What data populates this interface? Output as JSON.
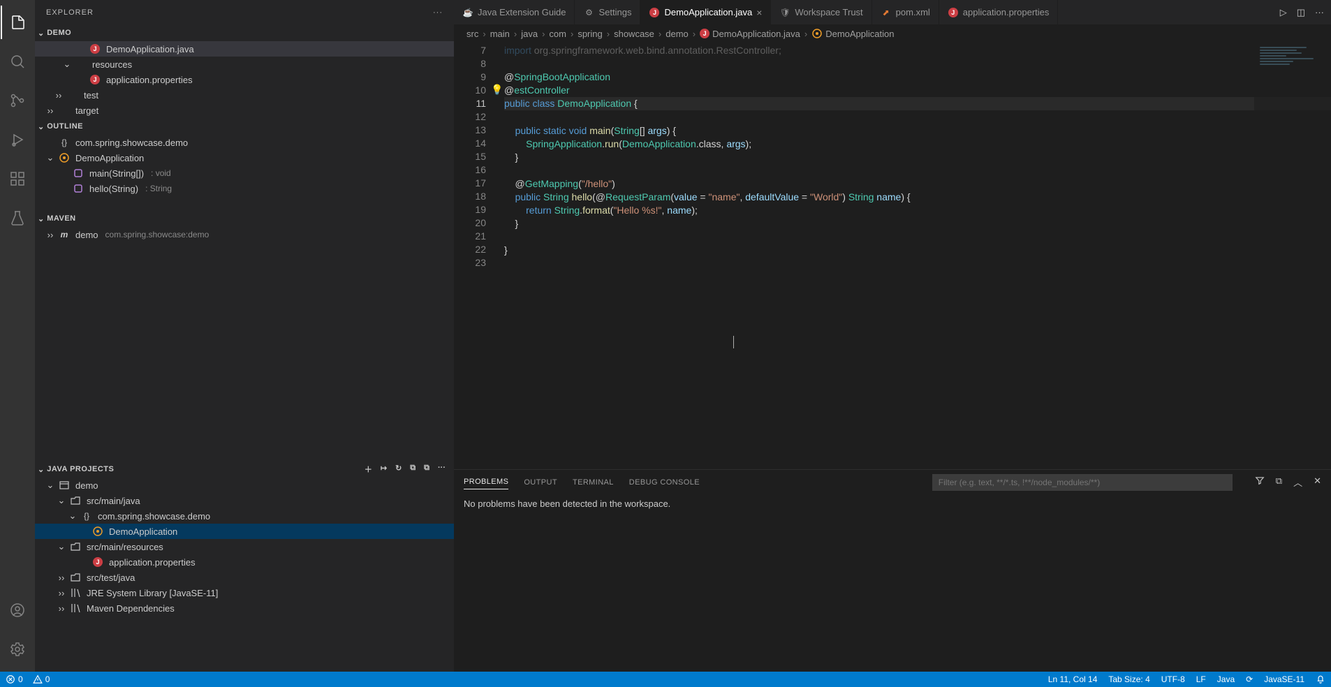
{
  "sidebar": {
    "title": "EXPLORER",
    "sections": {
      "demo": {
        "label": "DEMO",
        "items": [
          {
            "label": "DemoApplication.java",
            "kind": "java",
            "indent": 58,
            "active": true
          },
          {
            "label": "resources",
            "kind": "folder-open",
            "indent": 38
          },
          {
            "label": "application.properties",
            "kind": "prop",
            "indent": 58
          },
          {
            "label": "test",
            "kind": "folder",
            "indent": 26,
            "collapsed": true
          },
          {
            "label": "target",
            "kind": "folder",
            "indent": 14,
            "collapsed": true
          }
        ]
      },
      "outline": {
        "label": "OUTLINE",
        "items": [
          {
            "label": "com.spring.showcase.demo",
            "icon": "ns",
            "indent": 14
          },
          {
            "label": "DemoApplication",
            "icon": "class",
            "indent": 14,
            "expandable": true,
            "expanded": true
          },
          {
            "label": "main(String[])",
            "hint": ": void",
            "icon": "method",
            "indent": 34
          },
          {
            "label": "hello(String)",
            "hint": ": String",
            "icon": "method",
            "indent": 34
          }
        ]
      },
      "maven": {
        "label": "MAVEN",
        "items": [
          {
            "label": "demo",
            "hint": "com.spring.showcase:demo",
            "icon": "maven",
            "indent": 14,
            "collapsed": true
          }
        ]
      },
      "javaProjects": {
        "label": "JAVA PROJECTS",
        "items": [
          {
            "label": "demo",
            "icon": "proj",
            "indent": 14,
            "expandable": true,
            "expanded": true
          },
          {
            "label": "src/main/java",
            "icon": "pkg-root",
            "indent": 30,
            "expandable": true,
            "expanded": true
          },
          {
            "label": "com.spring.showcase.demo",
            "icon": "ns",
            "indent": 46,
            "expandable": true,
            "expanded": true
          },
          {
            "label": "DemoApplication",
            "icon": "class",
            "indent": 62,
            "selected": true
          },
          {
            "label": "src/main/resources",
            "icon": "pkg-root",
            "indent": 30,
            "expandable": true,
            "expanded": true
          },
          {
            "label": "application.properties",
            "icon": "prop",
            "indent": 62
          },
          {
            "label": "src/test/java",
            "icon": "pkg-root",
            "indent": 30,
            "collapsed": true
          },
          {
            "label": "JRE System Library [JavaSE-11]",
            "icon": "lib",
            "indent": 30,
            "collapsed": true
          },
          {
            "label": "Maven Dependencies",
            "icon": "lib",
            "indent": 30,
            "collapsed": true
          }
        ]
      }
    }
  },
  "tabs": [
    {
      "label": "Java Extension Guide",
      "icon": "coffee"
    },
    {
      "label": "Settings",
      "icon": "settings"
    },
    {
      "label": "DemoApplication.java",
      "icon": "java",
      "active": true,
      "close": true
    },
    {
      "label": "Workspace Trust",
      "icon": "shield"
    },
    {
      "label": "pom.xml",
      "icon": "xml"
    },
    {
      "label": "application.properties",
      "icon": "prop"
    }
  ],
  "breadcrumbs": [
    "src",
    "main",
    "java",
    "com",
    "spring",
    "showcase",
    "demo",
    "DemoApplication.java",
    "DemoApplication"
  ],
  "code": {
    "startLine": 7,
    "lines": [
      {
        "n": 7,
        "html": "<span class='kw'>import</span> org.springframework.web.bind.annotation.RestController;",
        "faded": true
      },
      {
        "n": 8,
        "html": ""
      },
      {
        "n": 9,
        "html": "@<span class='an'>SpringBootApplication</span>"
      },
      {
        "n": 10,
        "html": "@<span class='an'>estController</span>"
      },
      {
        "n": 11,
        "html": "<span class='kw'>public</span> <span class='kw'>class</span> <span class='ty'>DemoApplication</span> {",
        "current": true
      },
      {
        "n": 12,
        "html": ""
      },
      {
        "n": 13,
        "html": "    <span class='kw'>public</span> <span class='kw'>static</span> <span class='kw'>void</span> <span class='fn'>main</span>(<span class='ty'>String</span>[] <span class='id'>args</span>) {"
      },
      {
        "n": 14,
        "html": "        <span class='ty'>SpringApplication</span>.<span class='fn'>run</span>(<span class='ty'>DemoApplication</span>.class, <span class='id'>args</span>);"
      },
      {
        "n": 15,
        "html": "    }"
      },
      {
        "n": 16,
        "html": ""
      },
      {
        "n": 17,
        "html": "    @<span class='an'>GetMapping</span>(<span class='st'>\"/hello\"</span>)"
      },
      {
        "n": 18,
        "html": "    <span class='kw'>public</span> <span class='ty'>String</span> <span class='fn'>hello</span>(@<span class='an'>RequestParam</span>(<span class='id'>value</span> = <span class='st'>\"name\"</span>, <span class='id'>defaultValue</span> = <span class='st'>\"World\"</span>) <span class='ty'>String</span> <span class='id'>name</span>) {"
      },
      {
        "n": 19,
        "html": "        <span class='kw'>return</span> <span class='ty'>String</span>.<span class='fn'>format</span>(<span class='st'>\"Hello %s!\"</span>, <span class='id'>name</span>);"
      },
      {
        "n": 20,
        "html": "    }"
      },
      {
        "n": 21,
        "html": ""
      },
      {
        "n": 22,
        "html": "}"
      },
      {
        "n": 23,
        "html": ""
      }
    ]
  },
  "panel": {
    "tabs": [
      "PROBLEMS",
      "OUTPUT",
      "TERMINAL",
      "DEBUG CONSOLE"
    ],
    "activeTab": "PROBLEMS",
    "filterPlaceholder": "Filter (e.g. text, **/*.ts, !**/node_modules/**)",
    "message": "No problems have been detected in the workspace."
  },
  "status": {
    "errors": "0",
    "warnings": "0",
    "lncol": "Ln 11, Col 14",
    "tabsize": "Tab Size: 4",
    "encoding": "UTF-8",
    "eol": "LF",
    "lang": "Java",
    "jdk": "JavaSE-11"
  }
}
